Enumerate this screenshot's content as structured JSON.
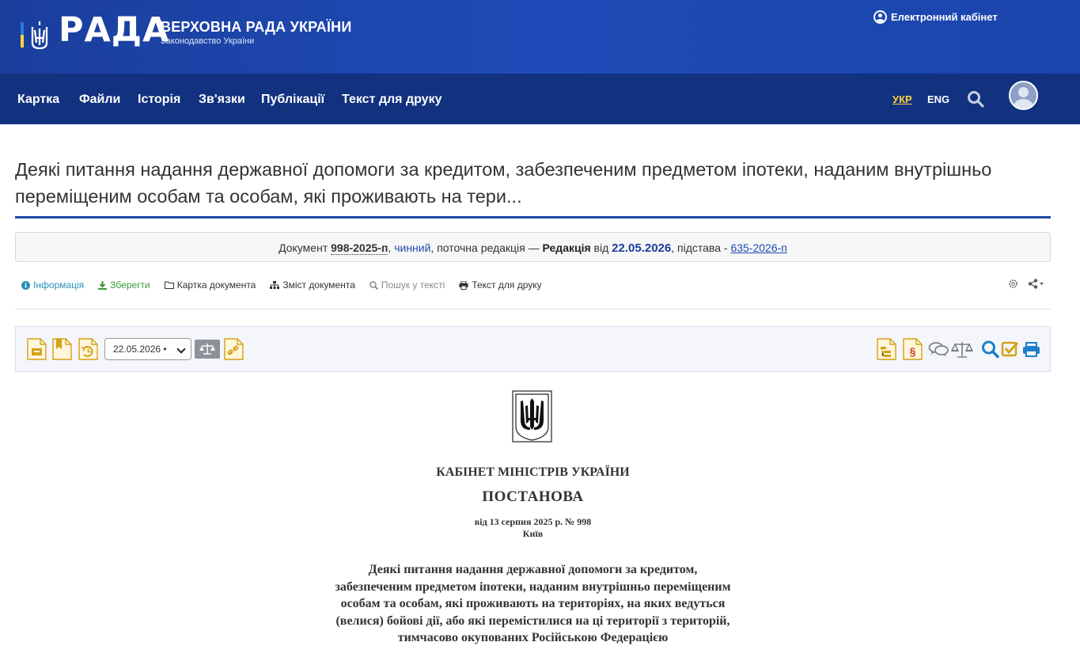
{
  "header": {
    "logo_text": "РАДА",
    "title": "ВЕРХОВНА РАДА УКРАЇНИ",
    "subtitle": "Законодавство України",
    "cabinet_label": "Електронний кабінет"
  },
  "nav": {
    "items": [
      "Картка",
      "Файли",
      "Історія",
      "Зв'язки",
      "Публікації",
      "Текст для друку"
    ],
    "lang_ukr": "УКР",
    "lang_eng": "ENG"
  },
  "page": {
    "heading": "Деякі питання надання державної допомоги за кредитом, забезпеченим предметом іпотеки, наданим внутрішньо переміщеним особам та особам, які проживають на тери..."
  },
  "status": {
    "prefix": "Документ",
    "number": "998-2025-п",
    "state": "чинний",
    "mid": ", поточна редакція —",
    "edition_label": "Редакція",
    "from": "від",
    "date": "22.05.2026",
    "basis_label": ", підстава -",
    "basis_link": "635-2026-п"
  },
  "toollinks": {
    "info": "Інформація",
    "save": "Зберегти",
    "card": "Картка документа",
    "contents": "Зміст документа",
    "search": "Пошук у тексті",
    "print": "Текст для друку"
  },
  "toolbar": {
    "date_value": "22.05.2026 •"
  },
  "document": {
    "org": "КАБІНЕТ МІНІСТРІВ УКРАЇНИ",
    "type": "ПОСТАНОВА",
    "date_line": "від 13 серпня 2025 р. № 998",
    "city": "Київ",
    "title": "Деякі питання надання державної допомоги за кредитом, забезпеченим предметом іпотеки, наданим внутрішньо переміщеним особам та особам, які проживають на територіях, на яких ведуться (велися) бойові дії, або які перемістилися на ці території з територій, тимчасово окупованих Російською Федерацією"
  },
  "colors": {
    "header_blue": "#1f4bb8",
    "nav_blue": "#12317f",
    "accent_yellow": "#ffd43b",
    "icon_gold": "#d4a017",
    "link_blue": "#1e4bb0"
  }
}
